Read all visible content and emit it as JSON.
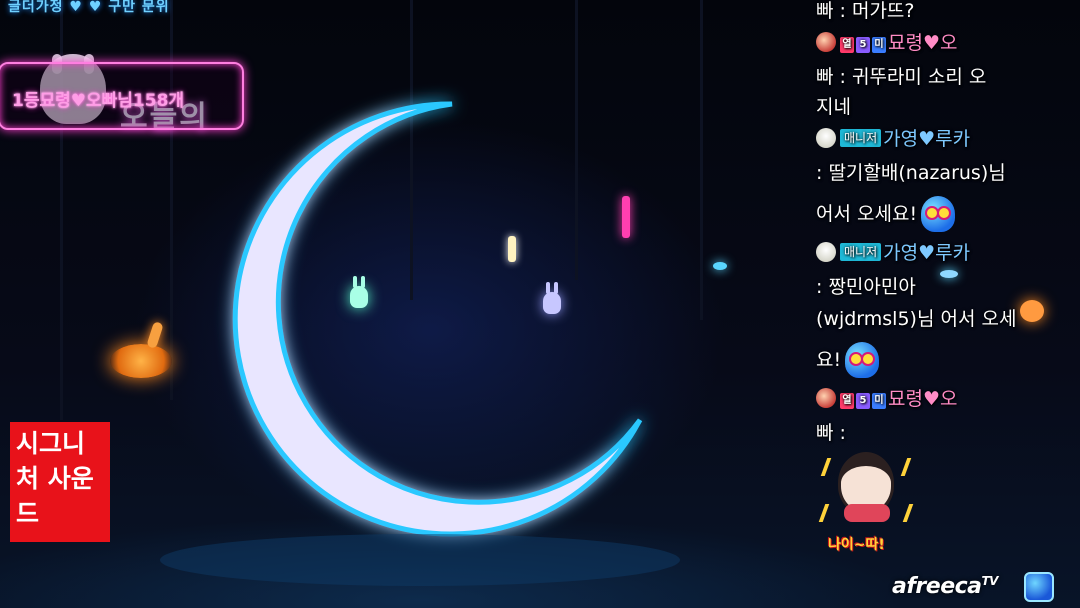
{
  "overlay": {
    "top_caption": "글더가정 ♥ ♥ 구만 문위",
    "stream_title": "오늘의",
    "donation_banner": "1등묘령♥오빠님158개"
  },
  "signature": {
    "line1": "시그니",
    "line2": "처 사운",
    "line3": "드"
  },
  "chat": {
    "messages": [
      {
        "text": "빠 : 머가뜨?"
      },
      {
        "badges": [
          "열",
          "5",
          "미"
        ],
        "nick": "묘령♥오"
      },
      {
        "text": "빠 : 귀뚜라미 소리 오"
      },
      {
        "text": "지네"
      },
      {
        "role": "매니저",
        "nick": "가영♥루카"
      },
      {
        "text": ": 딸기할배(nazarus)님"
      },
      {
        "text": "어서 오세요!"
      },
      {
        "role": "매니저",
        "nick": "가영♥루카"
      },
      {
        "text": ": 짱민아민아"
      },
      {
        "text": "(wjdrmsl5)님 어서 오세"
      },
      {
        "text": "요!"
      },
      {
        "badges": [
          "열",
          "5",
          "미"
        ],
        "nick": "묘령♥오"
      },
      {
        "text": "빠 :"
      }
    ],
    "sticker_caption": "나이~따!"
  },
  "watermark": {
    "brand": "afreeca",
    "suffix": "TV",
    "icon": "afreeca-mascot-icon"
  },
  "colors": {
    "moon": "#e9e6ff",
    "moon_glow": "#29c8ff",
    "banner_border": "#ff7ee0",
    "signature_bg": "#e8121a",
    "nick_pink": "#ff8cc6",
    "nick_manager": "#7ec9ff"
  }
}
